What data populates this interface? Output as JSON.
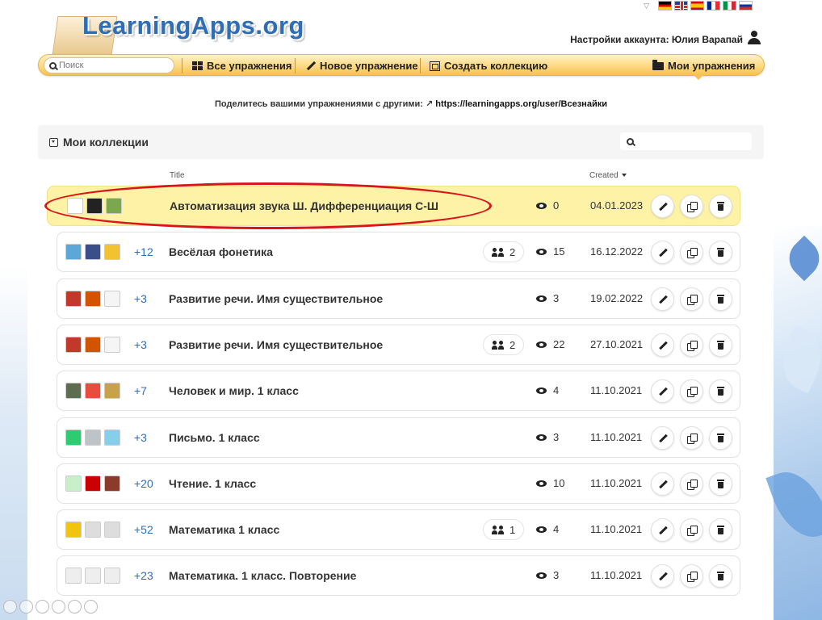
{
  "logo": {
    "text": "LearningApps.org"
  },
  "languages": [
    "de",
    "gb",
    "es",
    "fr",
    "it",
    "ru"
  ],
  "account": {
    "label": "Настройки аккаунта: Юлия Варапай"
  },
  "navbar": {
    "search_placeholder": "Поиск",
    "all_exercises": "Все упражнения",
    "new_exercise": "Новое упражнение",
    "create_collection": "Создать коллекцию",
    "my_exercises": "Мои упражнения"
  },
  "share": {
    "text": "Поделитесь вашими упражнениями с другими:",
    "link": "https://learningapps.org/user/Всезнайки"
  },
  "collections": {
    "title": "Мои коллекции",
    "col_title": "Title",
    "col_created": "Created",
    "rows": [
      {
        "thumbs": [
          "#ffffff",
          "#222222",
          "#7aa84e"
        ],
        "more": "",
        "title": "Автоматизация звука Ш. Дифференциация С-Ш",
        "shared": "",
        "views": "0",
        "date": "04.01.2023",
        "highlight": true
      },
      {
        "thumbs": [
          "#5aa7d8",
          "#3a4f8a",
          "#f3c230"
        ],
        "more": "+12",
        "title": "Весёлая фонетика",
        "shared": "2",
        "views": "15",
        "date": "16.12.2022",
        "highlight": false
      },
      {
        "thumbs": [
          "#c0392b",
          "#d35400",
          "#f5f5f5"
        ],
        "more": "+3",
        "title": "Развитие речи. Имя существительное",
        "shared": "",
        "views": "3",
        "date": "19.02.2022",
        "highlight": false
      },
      {
        "thumbs": [
          "#c0392b",
          "#d35400",
          "#f5f5f5"
        ],
        "more": "+3",
        "title": "Развитие речи. Имя существительное",
        "shared": "2",
        "views": "22",
        "date": "27.10.2021",
        "highlight": false
      },
      {
        "thumbs": [
          "#5d6d4e",
          "#e74c3c",
          "#c8a24a"
        ],
        "more": "+7",
        "title": "Человек и мир. 1 класс",
        "shared": "",
        "views": "4",
        "date": "11.10.2021",
        "highlight": false
      },
      {
        "thumbs": [
          "#2ecc71",
          "#bdc3c7",
          "#87ceeb"
        ],
        "more": "+3",
        "title": "Письмо. 1 класс",
        "shared": "",
        "views": "3",
        "date": "11.10.2021",
        "highlight": false
      },
      {
        "thumbs": [
          "#c8f0c8",
          "#cc0000",
          "#8b3a2b"
        ],
        "more": "+20",
        "title": "Чтение. 1 класс",
        "shared": "",
        "views": "10",
        "date": "11.10.2021",
        "highlight": false
      },
      {
        "thumbs": [
          "#f1c40f",
          "#dddddd",
          "#dddddd"
        ],
        "more": "+52",
        "title": "Математика 1 класс",
        "shared": "1",
        "views": "4",
        "date": "11.10.2021",
        "highlight": false
      },
      {
        "thumbs": [
          "#eeeeee",
          "#eeeeee",
          "#eeeeee"
        ],
        "more": "+23",
        "title": "Математика. 1 класс. Повторение",
        "shared": "",
        "views": "3",
        "date": "11.10.2021",
        "highlight": false
      }
    ]
  }
}
